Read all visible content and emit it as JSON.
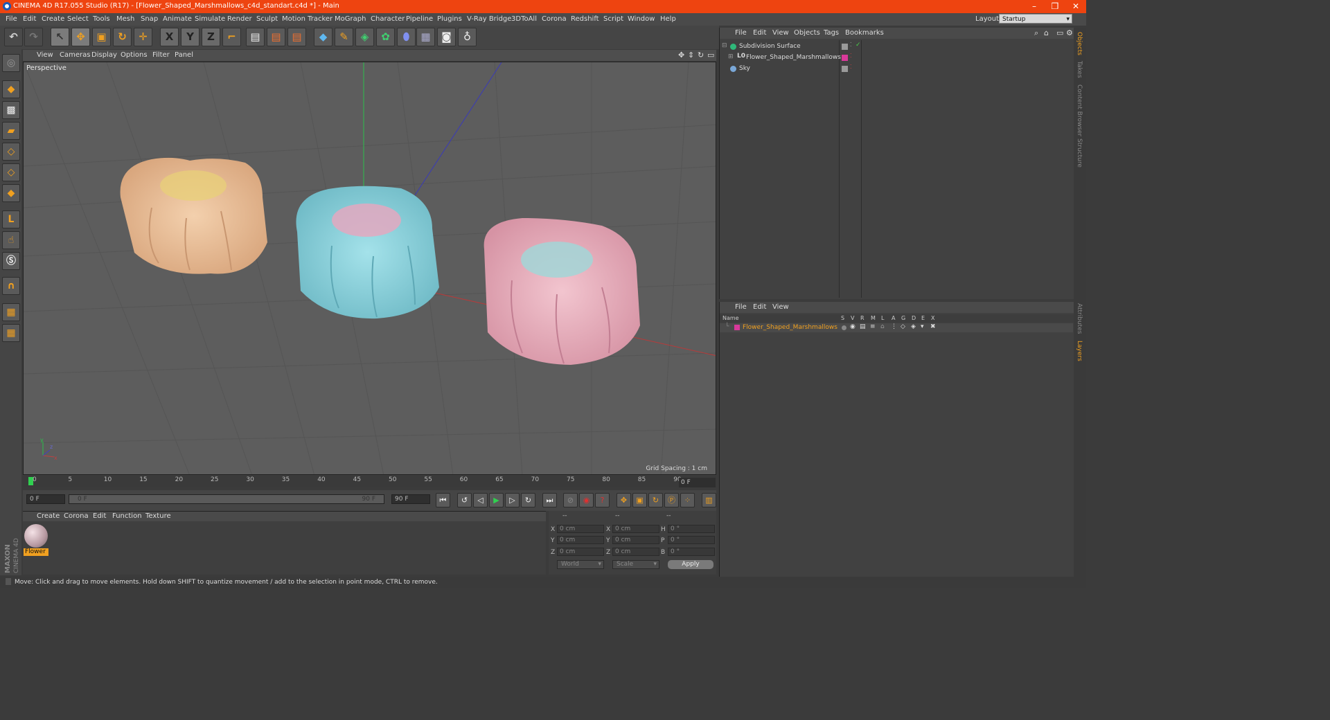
{
  "window": {
    "title": "CINEMA 4D R17.055 Studio (R17) - [Flower_Shaped_Marshmallows_c4d_standart.c4d *] - Main",
    "minimize": "–",
    "restore": "❒",
    "close": "✕"
  },
  "menubar": {
    "items": [
      "File",
      "Edit",
      "Create",
      "Select",
      "Tools",
      "Mesh",
      "Snap",
      "Animate",
      "Simulate",
      "Render",
      "Sculpt",
      "Motion Tracker",
      "MoGraph",
      "Character",
      "Pipeline",
      "Plugins",
      "V-Ray Bridge",
      "3DToAll",
      "Corona",
      "Redshift",
      "Script",
      "Window",
      "Help"
    ],
    "layout_label": "Layout:",
    "layout_value": "Startup"
  },
  "toolbar": {
    "axis_x": "X",
    "axis_y": "Y",
    "axis_z": "Z"
  },
  "viewport": {
    "menu": [
      "View",
      "Cameras",
      "Display",
      "Options",
      "Filter",
      "Panel"
    ],
    "label": "Perspective",
    "grid_spacing": "Grid Spacing : 1 cm",
    "axis_gizmo": {
      "y": "y",
      "x": "x",
      "z": "z"
    }
  },
  "timeline": {
    "ticks": [
      "0",
      "5",
      "10",
      "15",
      "20",
      "25",
      "30",
      "35",
      "40",
      "45",
      "50",
      "55",
      "60",
      "65",
      "70",
      "75",
      "80",
      "85",
      "90"
    ],
    "frame_end_field": "0 F"
  },
  "transport": {
    "start_field": "0 F",
    "range_start": "0 F",
    "range_end": "90 F",
    "end_field": "90 F"
  },
  "materials": {
    "menu": [
      "Create",
      "Corona",
      "Edit",
      "Function",
      "Texture"
    ],
    "items": [
      {
        "name": "Flower"
      }
    ]
  },
  "coordinates": {
    "headers": [
      "--",
      "--",
      "--"
    ],
    "rows": [
      {
        "axis": "X",
        "pos": "0 cm",
        "size_axis": "X",
        "size": "0 cm",
        "rot_axis": "H",
        "rot": "0 °"
      },
      {
        "axis": "Y",
        "pos": "0 cm",
        "size_axis": "Y",
        "size": "0 cm",
        "rot_axis": "P",
        "rot": "0 °"
      },
      {
        "axis": "Z",
        "pos": "0 cm",
        "size_axis": "Z",
        "size": "0 cm",
        "rot_axis": "B",
        "rot": "0 °"
      }
    ],
    "mode": "World",
    "scale_mode": "Scale",
    "apply": "Apply"
  },
  "object_manager": {
    "menu": [
      "File",
      "Edit",
      "View",
      "Objects",
      "Tags",
      "Bookmarks"
    ],
    "objects": [
      {
        "name": "Subdivision Surface",
        "color": "#2fb87a"
      },
      {
        "name": "Flower_Shaped_Marshmallows",
        "color": "#d8d8d8"
      },
      {
        "name": "Sky",
        "color": "#7aa8d8"
      }
    ]
  },
  "layer_manager": {
    "menu": [
      "File",
      "Edit",
      "View"
    ],
    "columns": [
      "Name",
      "S",
      "V",
      "R",
      "M",
      "L",
      "A",
      "G",
      "D",
      "E",
      "X"
    ],
    "layers": [
      {
        "name": "Flower_Shaped_Marshmallows",
        "color": "#d8399a"
      }
    ]
  },
  "right_tabs": [
    "Objects",
    "Takes",
    "Content Browser",
    "Structure",
    "Attributes",
    "Layers"
  ],
  "statusbar": {
    "text": "Move: Click and drag to move elements. Hold down SHIFT to quantize movement / add to the selection in point mode, CTRL to remove."
  },
  "branding": {
    "line1": "MAXON",
    "line2": "CINEMA 4D"
  },
  "colors": {
    "titlebar": "#ee4410",
    "accent_orange": "#f0a020",
    "flower_peach": "#e8bd97",
    "flower_blue": "#8fd3dd",
    "flower_pink": "#e8aebd"
  }
}
